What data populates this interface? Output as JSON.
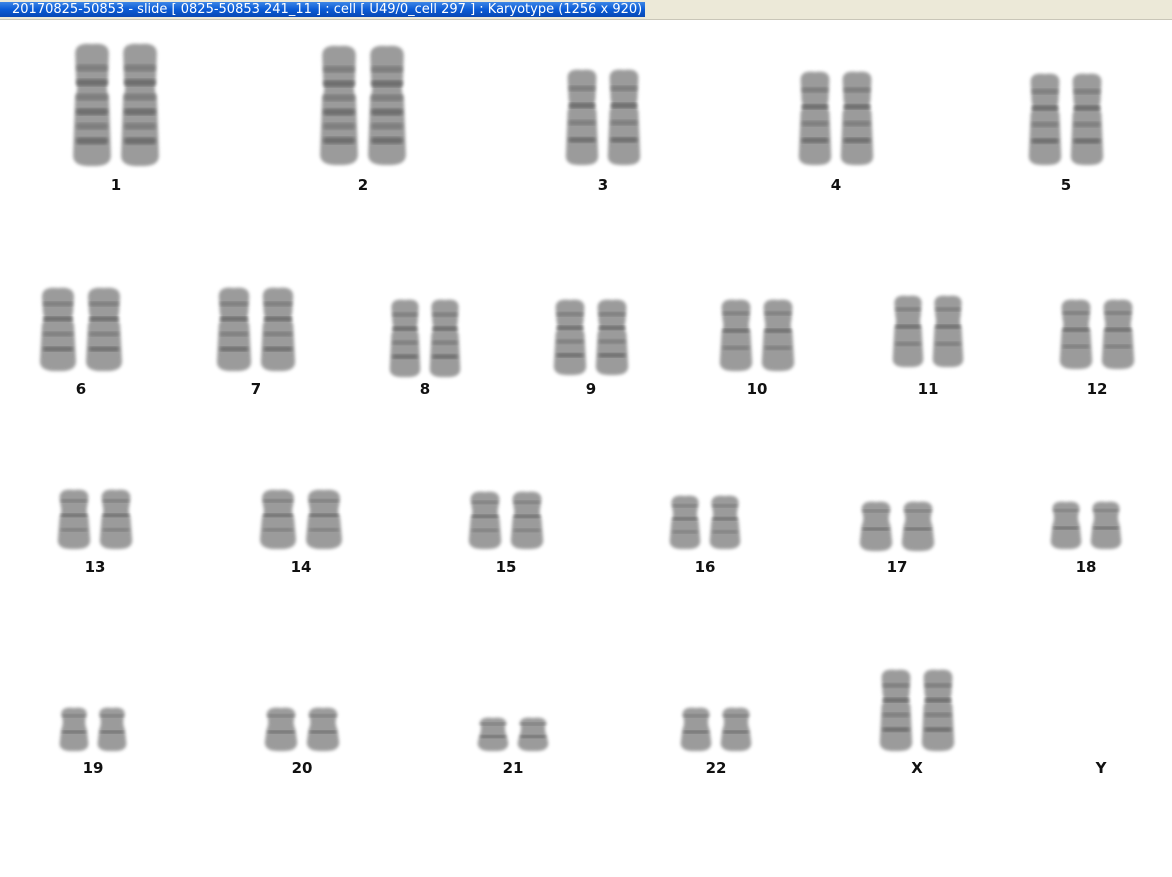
{
  "window": {
    "title": "20170825-50853 - slide [ 0825-50853 241_11 ] : cell [ U49/0_cell 297 ] : Karyotype  (1256 x 920)"
  },
  "karyotype": {
    "pairs": [
      {
        "label": "1"
      },
      {
        "label": "2"
      },
      {
        "label": "3"
      },
      {
        "label": "4"
      },
      {
        "label": "5"
      },
      {
        "label": "6"
      },
      {
        "label": "7"
      },
      {
        "label": "8"
      },
      {
        "label": "9"
      },
      {
        "label": "10"
      },
      {
        "label": "11"
      },
      {
        "label": "12"
      },
      {
        "label": "13"
      },
      {
        "label": "14"
      },
      {
        "label": "15"
      },
      {
        "label": "16"
      },
      {
        "label": "17"
      },
      {
        "label": "18"
      },
      {
        "label": "19"
      },
      {
        "label": "20"
      },
      {
        "label": "21"
      },
      {
        "label": "22"
      },
      {
        "label": "X"
      },
      {
        "label": "Y"
      }
    ]
  },
  "colors": {
    "chromosome_fill": "#8a8a8a",
    "chromosome_band": "#4a4a4a",
    "titlebar": "#0a5bd6"
  }
}
